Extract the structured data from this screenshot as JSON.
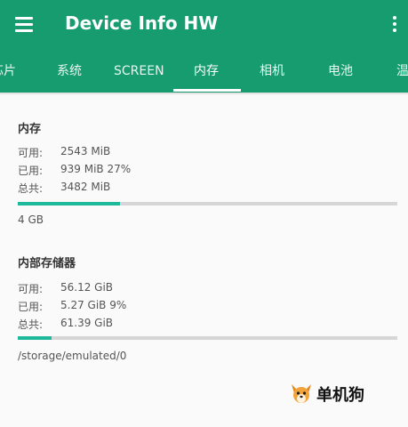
{
  "app": {
    "title": "Device Info HW"
  },
  "tabs": [
    {
      "label": "芯片",
      "active": false
    },
    {
      "label": "系统",
      "active": false
    },
    {
      "label": "SCREEN",
      "active": false
    },
    {
      "label": "内存",
      "active": true
    },
    {
      "label": "相机",
      "active": false
    },
    {
      "label": "电池",
      "active": false
    },
    {
      "label": "温",
      "active": false
    }
  ],
  "memory": {
    "title": "内存",
    "available_label": "可用:",
    "available_value": "2543 MiB",
    "used_label": "已用:",
    "used_value": "939 MiB 27%",
    "total_label": "总共:",
    "total_value": "3482 MiB",
    "usage_fraction": 0.27,
    "size_text": "4 GB"
  },
  "storage": {
    "title": "内部存储器",
    "available_label": "可用:",
    "available_value": "56.12 GiB",
    "used_label": "已用:",
    "used_value": "5.27 GiB 9%",
    "total_label": "总共:",
    "total_value": "61.39 GiB",
    "usage_fraction": 0.09,
    "path": "/storage/emulated/0"
  },
  "watermark": {
    "text": "单机狗"
  },
  "colors": {
    "appbar": "#169c6f",
    "progress": "#1db99a",
    "track": "#d6d6d6"
  }
}
